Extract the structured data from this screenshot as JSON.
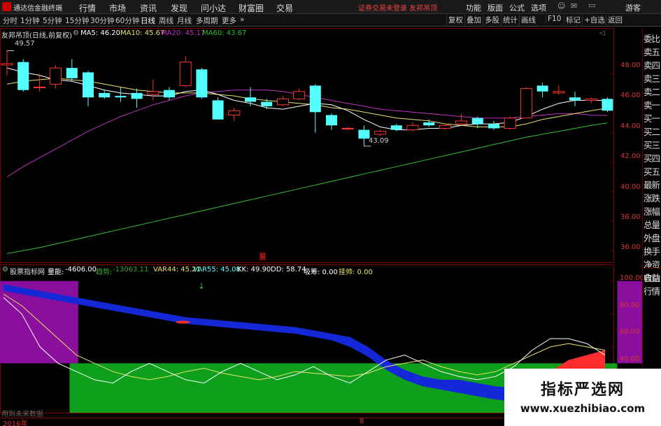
{
  "app": {
    "title": "通达信金融终端"
  },
  "menu": {
    "items": [
      "行情",
      "市场",
      "资讯",
      "发现",
      "问小达",
      "财富圈",
      "交易"
    ],
    "warning": "证券交易未登录  友邦吊顶",
    "right_items": [
      "功能",
      "版面",
      "公式",
      "选项"
    ],
    "guest": "游客"
  },
  "toolbar": {
    "periods": [
      "分时",
      "1分钟",
      "5分钟",
      "15分钟",
      "30分钟",
      "60分钟",
      "日线",
      "周线",
      "月线",
      "多周期",
      "更多"
    ],
    "active_period": "日线",
    "right_tools": [
      "复权",
      "叠加",
      "多股",
      "统计",
      "画线",
      "F10",
      "标记",
      "+自选",
      "返回"
    ]
  },
  "main_chart": {
    "header_name": "友邦吊顶(日线,前复权)",
    "ma5": "MA5: 46.20",
    "ma10": "MA10: 45.67",
    "ma20": "MA20: 45.17",
    "ma60": "MA60: 43.67",
    "high_label": "49.57",
    "low_label": "43.09",
    "marker": "层",
    "y_ticks": [
      "48.00",
      "46.00",
      "44.00",
      "42.00",
      "40.00",
      "38.00",
      "36.00"
    ],
    "colors": {
      "up": "#ff3333",
      "down": "#54ffff",
      "ma5": "#ffffff",
      "ma10": "#e8e36a",
      "ma20": "#c031c0",
      "ma60": "#2fc02f"
    }
  },
  "indicator": {
    "name": "股票指标网",
    "vol_label": "量能: ",
    "vol_value": "-4606.00",
    "trend_label": "趋势: ",
    "trend_value": "-13063.11",
    "var44": "VAR44: 45.21",
    "var55": "VAR55: 45.08",
    "kk": "KK: 49.90",
    "dd": "DD: 58.74",
    "xiaoxiao": "吸筹: 0.00",
    "guashuai": "挂帅: 0.00",
    "y_ticks": [
      "100.00",
      "80.00",
      "60.00",
      "40.00"
    ],
    "footer": "用到未来数据",
    "year_label": "2016年",
    "month_label": "8"
  },
  "right_panel": {
    "items": [
      "委比",
      "卖五",
      "卖四",
      "卖三",
      "卖二",
      "卖一",
      "买一",
      "买二",
      "买三",
      "买四",
      "买五",
      "最新",
      "涨跌",
      "涨幅",
      "总量",
      "外盘",
      "换手",
      "净资",
      "收益",
      "自动",
      "行情"
    ]
  },
  "watermark": {
    "cn": "指标严选网",
    "url": "www.xuezhibiao.com"
  },
  "chart_data": {
    "type": "candlestick",
    "candles": [
      {
        "o": 48.6,
        "c": 48.7,
        "h": 49.57,
        "l": 47.9
      },
      {
        "o": 48.8,
        "c": 46.9,
        "h": 49.0,
        "l": 46.8
      },
      {
        "o": 47.1,
        "c": 47.1,
        "h": 48.0,
        "l": 46.8
      },
      {
        "o": 47.3,
        "c": 48.4,
        "h": 48.6,
        "l": 47.0
      },
      {
        "o": 48.4,
        "c": 47.7,
        "h": 49.0,
        "l": 47.5
      },
      {
        "o": 48.1,
        "c": 46.4,
        "h": 48.2,
        "l": 45.8
      },
      {
        "o": 46.7,
        "c": 46.4,
        "h": 46.9,
        "l": 46.3
      },
      {
        "o": 46.5,
        "c": 46.4,
        "h": 47.1,
        "l": 46.1
      },
      {
        "o": 46.7,
        "c": 46.3,
        "h": 47.0,
        "l": 45.7
      },
      {
        "o": 46.6,
        "c": 46.8,
        "h": 47.6,
        "l": 46.2
      },
      {
        "o": 46.9,
        "c": 46.4,
        "h": 47.1,
        "l": 46.2
      },
      {
        "o": 47.2,
        "c": 48.8,
        "h": 49.2,
        "l": 47.1
      },
      {
        "o": 48.3,
        "c": 46.4,
        "h": 48.4,
        "l": 46.3
      },
      {
        "o": 46.2,
        "c": 44.9,
        "h": 46.4,
        "l": 44.9
      },
      {
        "o": 45.2,
        "c": 45.5,
        "h": 45.7,
        "l": 44.8
      },
      {
        "o": 46.4,
        "c": 46.1,
        "h": 47.1,
        "l": 45.8
      },
      {
        "o": 46.1,
        "c": 45.8,
        "h": 46.3,
        "l": 45.6
      },
      {
        "o": 45.9,
        "c": 46.3,
        "h": 46.5,
        "l": 45.8
      },
      {
        "o": 46.3,
        "c": 46.8,
        "h": 47.0,
        "l": 46.2
      },
      {
        "o": 47.2,
        "c": 45.4,
        "h": 47.3,
        "l": 44.0
      },
      {
        "o": 45.2,
        "c": 44.5,
        "h": 45.3,
        "l": 44.2
      },
      {
        "o": 44.3,
        "c": 44.3,
        "h": 44.4,
        "l": 44.2
      },
      {
        "o": 44.2,
        "c": 43.6,
        "h": 44.5,
        "l": 43.09
      },
      {
        "o": 43.9,
        "c": 44.1,
        "h": 44.2,
        "l": 43.8
      },
      {
        "o": 44.5,
        "c": 44.2,
        "h": 44.6,
        "l": 44.1
      },
      {
        "o": 44.2,
        "c": 44.5,
        "h": 44.7,
        "l": 44.1
      },
      {
        "o": 44.7,
        "c": 44.5,
        "h": 44.9,
        "l": 44.4
      },
      {
        "o": 44.3,
        "c": 44.5,
        "h": 44.6,
        "l": 44.2
      },
      {
        "o": 44.6,
        "c": 44.8,
        "h": 45.3,
        "l": 44.5
      },
      {
        "o": 45.0,
        "c": 44.6,
        "h": 45.1,
        "l": 44.3
      },
      {
        "o": 44.6,
        "c": 44.3,
        "h": 44.8,
        "l": 44.2
      },
      {
        "o": 44.3,
        "c": 45.0,
        "h": 45.1,
        "l": 44.2
      },
      {
        "o": 45.0,
        "c": 47.0,
        "h": 47.1,
        "l": 45.0
      },
      {
        "o": 47.2,
        "c": 46.8,
        "h": 47.4,
        "l": 46.4
      },
      {
        "o": 46.7,
        "c": 46.8,
        "h": 47.2,
        "l": 46.6
      },
      {
        "o": 46.4,
        "c": 46.2,
        "h": 46.8,
        "l": 45.8
      },
      {
        "o": 46.2,
        "c": 46.3,
        "h": 46.4,
        "l": 46.0
      },
      {
        "o": 46.3,
        "c": 45.5,
        "h": 46.4,
        "l": 45.4
      }
    ],
    "ma5": [
      48.4,
      48.1,
      47.9,
      47.6,
      47.5,
      47.2,
      46.9,
      46.7,
      46.6,
      46.5,
      46.5,
      46.8,
      46.9,
      46.6,
      46.2,
      46.0,
      45.7,
      45.6,
      45.8,
      46.0,
      45.9,
      45.5,
      44.9,
      44.4,
      44.2,
      44.2,
      44.3,
      44.3,
      44.5,
      44.6,
      44.6,
      44.7,
      45.1,
      45.6,
      46.0,
      46.2,
      46.2,
      46.2
    ],
    "ma10": [
      47.3,
      47.5,
      47.6,
      47.7,
      47.6,
      47.5,
      47.3,
      47.1,
      46.9,
      46.8,
      46.7,
      46.7,
      46.7,
      46.6,
      46.5,
      46.3,
      46.2,
      46.1,
      46.0,
      45.9,
      45.7,
      45.6,
      45.4,
      45.2,
      45.0,
      44.9,
      44.8,
      44.6,
      44.5,
      44.4,
      44.4,
      44.4,
      44.6,
      44.9,
      45.1,
      45.3,
      45.5,
      45.67
    ],
    "ma20": [
      41.0,
      41.7,
      42.3,
      42.9,
      43.5,
      44.1,
      44.6,
      45.1,
      45.5,
      45.9,
      46.2,
      46.5,
      46.7,
      46.8,
      46.9,
      46.9,
      46.9,
      46.8,
      46.6,
      46.4,
      46.2,
      46.0,
      45.8,
      45.6,
      45.5,
      45.4,
      45.3,
      45.2,
      45.1,
      45.0,
      45.0,
      45.0,
      45.1,
      45.2,
      45.3,
      45.3,
      45.2,
      45.17
    ],
    "ma60": [
      35.8,
      36.0,
      36.2,
      36.45,
      36.7,
      36.95,
      37.2,
      37.45,
      37.7,
      37.95,
      38.2,
      38.45,
      38.7,
      38.95,
      39.2,
      39.45,
      39.7,
      39.95,
      40.2,
      40.45,
      40.7,
      40.95,
      41.2,
      41.45,
      41.7,
      41.95,
      42.2,
      42.45,
      42.7,
      42.95,
      43.2,
      43.45,
      43.7,
      43.9,
      44.1,
      44.3,
      44.5,
      44.67
    ],
    "ylim": [
      35.3,
      50.4
    ],
    "indicator": {
      "ylim": [
        20,
        102
      ],
      "zones": [
        {
          "name": "purple-left",
          "from": 0,
          "to": 4.5,
          "low": 50,
          "high": 100
        },
        {
          "name": "purple-right",
          "from": 35.5,
          "to": 37.4,
          "low": 50,
          "high": 100
        },
        {
          "name": "green-band",
          "from": 4,
          "to": 35.5,
          "low": 20,
          "high": 50
        }
      ],
      "ribbon_top": [
        98,
        96,
        94,
        92,
        90,
        88,
        86,
        84,
        82,
        80,
        78,
        77,
        76,
        75,
        74,
        73,
        72,
        70,
        68,
        66,
        60,
        52,
        46,
        42,
        40,
        40,
        38,
        36,
        35,
        37,
        45,
        52,
        55,
        58
      ],
      "ribbon_bot": [
        94,
        92,
        90,
        88,
        86,
        84,
        82,
        80,
        78,
        76,
        74,
        73,
        72,
        71,
        70,
        69,
        68,
        66,
        64,
        60,
        54,
        46,
        40,
        36,
        34,
        32,
        30,
        28,
        27,
        30,
        35,
        40,
        42,
        44
      ],
      "line_white": [
        90,
        80,
        60,
        50,
        45,
        40,
        38,
        45,
        50,
        45,
        40,
        38,
        45,
        50,
        45,
        40,
        43,
        48,
        42,
        38,
        45,
        52,
        55,
        50,
        45,
        42,
        40,
        42,
        48,
        58,
        65,
        65,
        62,
        55
      ],
      "line_yellow": [
        92,
        85,
        75,
        65,
        55,
        50,
        45,
        42,
        40,
        42,
        45,
        47,
        44,
        42,
        40,
        42,
        45,
        44,
        43,
        42,
        44,
        48,
        50,
        52,
        48,
        45,
        43,
        45,
        50,
        55,
        60,
        62,
        60,
        58
      ]
    }
  }
}
